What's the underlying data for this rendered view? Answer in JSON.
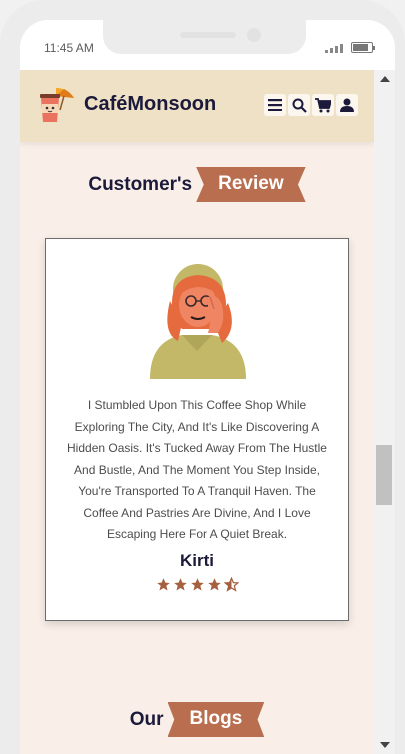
{
  "status_bar": {
    "time": "11:45 AM"
  },
  "header": {
    "brand": "CaféMonsoon",
    "icons": [
      "menu-icon",
      "search-icon",
      "cart-icon",
      "user-icon"
    ]
  },
  "reviews_section": {
    "title_dark": "Customer's",
    "title_ribbon": "Review",
    "card": {
      "text": "I Stumbled Upon This Coffee Shop While Exploring The City, And It's Like Discovering A Hidden Oasis. It's Tucked Away From The Hustle And Bustle, And The Moment You Step Inside, You're Transported To A Tranquil Haven. The Coffee And Pastries Are Divine, And I Love Escaping Here For A Quiet Break.",
      "reviewer": "Kirti",
      "rating": 4.5,
      "rating_max": 5
    }
  },
  "blogs_section": {
    "title_dark": "Our",
    "title_ribbon": "Blogs"
  },
  "colors": {
    "header_bg": "#efe1c5",
    "page_bg": "#f9efe8",
    "accent": "#b86e4f",
    "dark_text": "#1c1a3b"
  }
}
